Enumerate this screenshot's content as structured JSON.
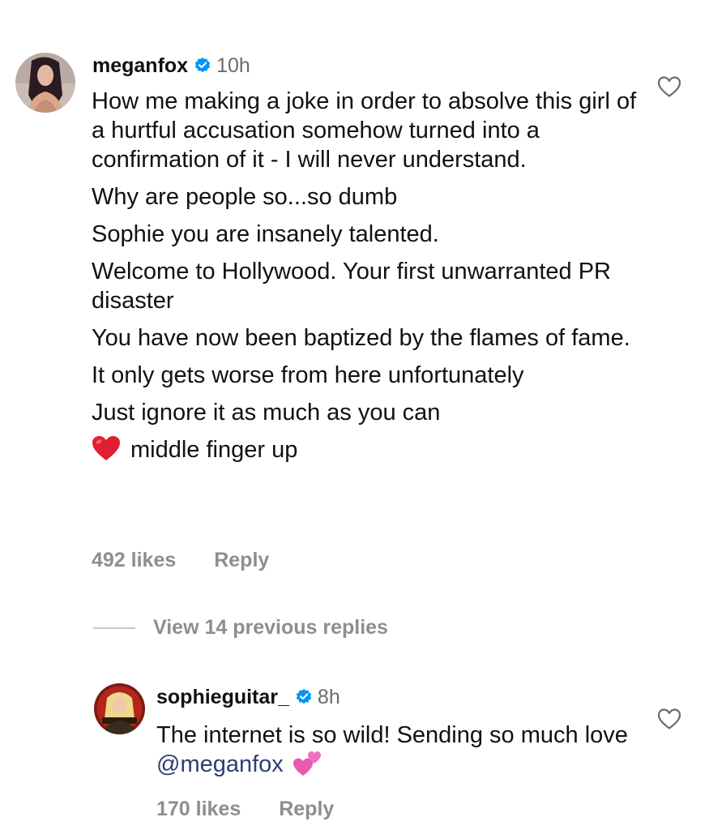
{
  "comment": {
    "username": "meganfox",
    "time": "10h",
    "paragraphs": [
      "How me making a joke in order to absolve this girl of a hurtful accusation somehow turned into a confirmation of it - I will never understand.",
      "Why are people so...so dumb",
      "Sophie you are insanely talented.",
      "Welcome to Hollywood. Your first unwarranted PR disaster",
      "You have now been baptized by the flames of fame.",
      "It only gets worse from here unfortunately",
      "Just ignore it as much as you can"
    ],
    "last_line": "middle finger up",
    "likes": "492 likes",
    "reply_label": "Reply"
  },
  "view_replies": {
    "label": "View 14 previous replies"
  },
  "reply": {
    "username": "sophieguitar_",
    "time": "8h",
    "text": "The internet is so wild! Sending so much love ",
    "mention": "@meganfox",
    "likes": "170 likes",
    "reply_label": "Reply"
  },
  "colors": {
    "verified_badge": "#0095f6",
    "mention": "#2c3f73",
    "muted_text": "#8e8e8e",
    "heart_emoji": "#e0202e"
  },
  "icons": {
    "like": "heart-outline-icon",
    "verified": "verified-badge-icon",
    "emoji_1": "red-heart-emoji",
    "emoji_2": "two-hearts-emoji"
  }
}
